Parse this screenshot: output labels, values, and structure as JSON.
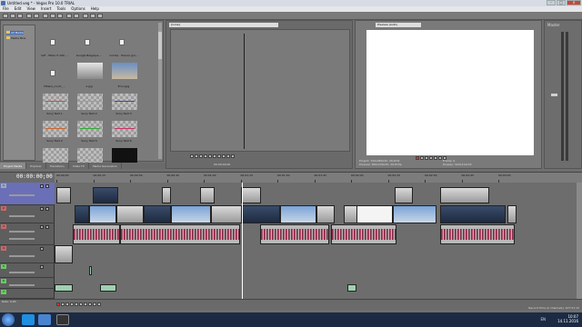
{
  "window": {
    "title": "Untitled.veg * - Vegas Pro 10.0 TRIAL",
    "buttons": [
      "-",
      "□",
      "×"
    ]
  },
  "menu": [
    "File",
    "Edit",
    "View",
    "Insert",
    "Tools",
    "Options",
    "Help"
  ],
  "media_panel": {
    "tree": [
      "All Media",
      "Media Bins"
    ],
    "items": [
      {
        "caption": "GIF - Hitler If 100 ...",
        "kind": "file"
      },
      {
        "caption": "Google Belgique ...",
        "kind": "file"
      },
      {
        "caption": "Cortex - Parure (Jul...",
        "kind": "file"
      },
      {
        "caption": "Hitlers_court_...",
        "kind": "file"
      },
      {
        "caption": "1.jpg",
        "kind": "photo"
      },
      {
        "caption": "Error.jpg",
        "kind": "photo"
      },
      {
        "caption": "Sony Text 1",
        "kind": "generator",
        "bar": "#d44"
      },
      {
        "caption": "Sony Text 2",
        "kind": "generator",
        "bar": "#8a8"
      },
      {
        "caption": "Sony Text 3",
        "kind": "generator",
        "bar": "#44a"
      },
      {
        "caption": "Sony Text 4",
        "kind": "generator",
        "bar": "#c63"
      },
      {
        "caption": "Sony Text 5",
        "kind": "generator",
        "bar": "#3a3"
      },
      {
        "caption": "Sony Text 6",
        "kind": "generator",
        "bar": "#c36"
      },
      {
        "caption": "Sony Text 7",
        "kind": "generator",
        "bar": ""
      },
      {
        "caption": "Sony Text 8",
        "kind": "generator",
        "bar": ""
      },
      {
        "caption": "Sony Text 9",
        "kind": "generator",
        "bar": ""
      }
    ],
    "tabs": [
      "Project Media",
      "Explorer",
      "Transitions",
      "Video FX",
      "Media Generators"
    ]
  },
  "trimmer": {
    "dropdown": "[none]",
    "time": "00:00:00;00"
  },
  "preview": {
    "dropdown": "Preview (Auto)",
    "project_label": "Project:",
    "project": "720x480x32, 29,970i",
    "preview_label": "Preview:",
    "preview": "360x240x32, 29,970p",
    "frame_label": "Frame:",
    "frame": "0",
    "display_label": "Display:",
    "display": "320x214x32"
  },
  "master": {
    "label": "Master"
  },
  "timeline": {
    "timecode": "00:00:00;00",
    "ruler": [
      "00:00:00",
      "00:00:15",
      "00:00:30",
      "00:00:45",
      "00:01:00",
      "00:01:15",
      "00:01:30",
      "00:01:45",
      "00:02:00",
      "00:02:15",
      "00:02:30",
      "00:02:45",
      "00:03:00"
    ],
    "tracks": [
      "1",
      "2",
      "3",
      "4",
      "5",
      "6",
      "7"
    ]
  },
  "bottom": {
    "rate": "Rate: 0,00",
    "status": "Record Time (2 channels): 107:51:15"
  },
  "taskbar": {
    "time": "10:07",
    "date": "14.11.2016",
    "lang": "EN"
  }
}
